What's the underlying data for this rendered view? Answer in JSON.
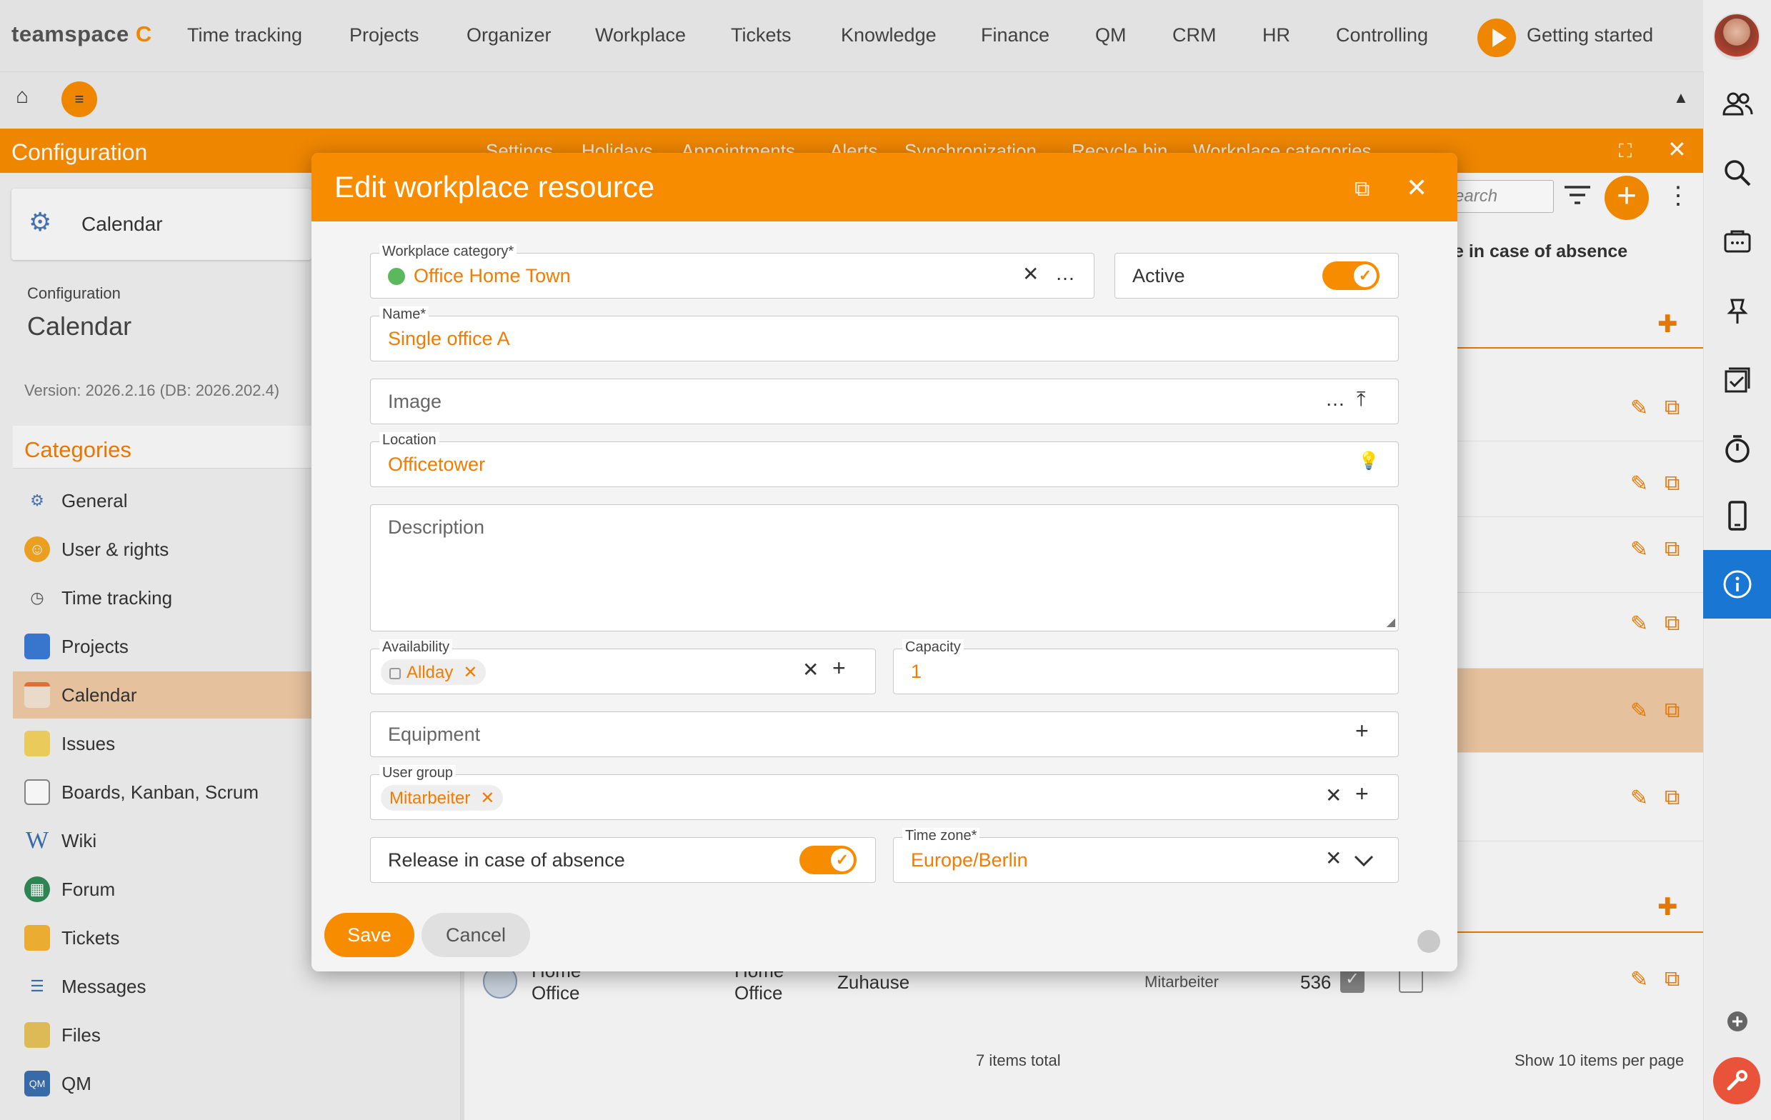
{
  "topnav": {
    "logo_text": "teamspace",
    "logo_mark": "C",
    "items": [
      "Time tracking",
      "Projects",
      "Organizer",
      "Workplace",
      "Tickets",
      "Knowledge",
      "Finance",
      "QM",
      "CRM",
      "HR",
      "Controlling"
    ],
    "getting_started": "Getting started",
    "accent": "#f88c00"
  },
  "subbar": {
    "home_icon": "⌂",
    "menu_icon": "≡",
    "collapse_icon": "▲"
  },
  "left": {
    "header": "Configuration",
    "card_label": "Calendar",
    "config_small": "Configuration",
    "config_big": "Calendar",
    "version": "Version: 2026.2.16 (DB: 2026.202.4)",
    "categories_title": "Categories",
    "items": [
      {
        "label": "General",
        "icon": "gear-icon"
      },
      {
        "label": "User & rights",
        "icon": "users-icon"
      },
      {
        "label": "Time tracking",
        "icon": "stopwatch-icon"
      },
      {
        "label": "Projects",
        "icon": "folder-icon"
      },
      {
        "label": "Calendar",
        "icon": "calendar-icon"
      },
      {
        "label": "Issues",
        "icon": "note-icon"
      },
      {
        "label": "Boards, Kanban, Scrum",
        "icon": "board-icon"
      },
      {
        "label": "Wiki",
        "icon": "wiki-icon"
      },
      {
        "label": "Forum",
        "icon": "forum-icon"
      },
      {
        "label": "Tickets",
        "icon": "ticket-icon"
      },
      {
        "label": "Messages",
        "icon": "messages-icon"
      },
      {
        "label": "Files",
        "icon": "files-icon"
      },
      {
        "label": "QM",
        "icon": "qm-icon"
      }
    ]
  },
  "background": {
    "tabs": [
      "Settings",
      "Holidays",
      "Appointments",
      "Alerts",
      "Synchronization",
      "Recycle bin",
      "Workplace categories"
    ],
    "search_placeholder": "earch",
    "column_header": "e in case of absence",
    "last_row": {
      "col1": "Home Office",
      "col2": "Home Office",
      "col3": "Zuhause",
      "col4": "Mitarbeiter",
      "col5": "536"
    },
    "footer_total": "7 items total",
    "footer_show": "Show  10  items per page"
  },
  "dialog": {
    "title": "Edit workplace resource",
    "workplace_category": {
      "label": "Workplace category*",
      "value": "Office Home Town"
    },
    "active": {
      "label": "Active",
      "on": true
    },
    "name": {
      "label": "Name*",
      "value": "Single office A"
    },
    "image": {
      "placeholder": "Image"
    },
    "location": {
      "label": "Location",
      "value": "Officetower"
    },
    "description": {
      "placeholder": "Description"
    },
    "availability": {
      "label": "Availability",
      "chip": "Allday"
    },
    "capacity": {
      "label": "Capacity",
      "value": "1"
    },
    "equipment": {
      "placeholder": "Equipment"
    },
    "user_group": {
      "label": "User group",
      "chip": "Mitarbeiter"
    },
    "release": {
      "label": "Release in case of absence",
      "on": true
    },
    "time_zone": {
      "label": "Time zone*",
      "value": "Europe/Berlin"
    },
    "save_label": "Save",
    "cancel_label": "Cancel"
  }
}
